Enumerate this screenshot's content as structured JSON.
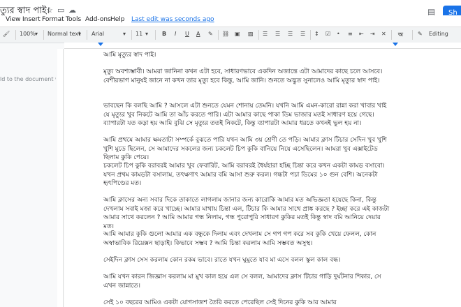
{
  "title": "ত্যুর স্বাদ পাই।",
  "menu": {
    "items": [
      "View",
      "Insert",
      "Format",
      "Tools",
      "Add-ons",
      "Help"
    ],
    "last_edit": "Last edit was seconds ago"
  },
  "share": {
    "label": "Sh"
  },
  "toolbar": {
    "zoom": "100%",
    "style": "Normal text",
    "font": "Arial",
    "size": "11",
    "mode": "Editing"
  },
  "outline_hint": "ld to the document will",
  "document": {
    "paragraphs": [
      "আমি মৃত্যুর স্বাদ পাই।",
      "মৃত্যু অবশ্যম্ভাবী। আমরা জানিনা কখন এটা হবে, সাধারণভাবে একদিন অজান্তে এটা আমাদের কাছে চলে আসবে। বেশীরভাগ মানুষই জানে না কখন তার মৃত্যু হবে কিন্তু, আমি জানি। শুনতে অদ্ভুত সুনালেও আমি মৃত্যুর স্বাদ পাই।",
      "ভাবছেন কি বলছি আমি ? আসলে এটা শুনতে যেমন শোনায় তেমনি। যখনি আমি এমন-কারো রান্না করা খাবার খাই যে মৃত্যুর খুব নিকটে আমি তা আঁচ করতে পারি। এটা আমার কাছে পাকা ডিম ভাজার মতই সাধারণ হয়ে গেছে। ব্যাপারটা যত কড়া হয় আমি বুঝি সে মৃত্যুর ততই নিকটে, কিন্তু ব্যাপারটা আমার ধরতে কখনই ভুল হয় না।",
      "আমি প্রথমে আমার ক্ষমতাটা সম্পর্কে বুঝতে পারি যখন আমি ৩য় শ্রেণী তে পড়ি। আমার ক্লাস টিচার সেদিন খুব খুশি খুশি মুডে ছিলেন, সে আমাদের সকলের জন্য চকলেট চিপ কুকি বানিয়ে নিয়ে এসেছিলেন। আমরা খুব এক্সাইটেড ছিলাম কুকি পেয়ে।",
      "চকলেট চিপ কুকি বরাবরই আমার খুব ফেবারিট, আমি বরাবরই ধৈর্যহারা হচ্ছি চিন্তা করে কখন একটা কামড় বসাবো। যখন প্রথম কামড়টা বসালাম, তৎক্ষণাৎ আমার বমি আসা শুরু করল। গন্ধটা পচা ডিমের ১০ গুন বেশি। অনেকটা হৃৎপিণ্ডের মত।",
      "আমি ক্লাসের অন্য সবার দিকে তাকাতে লাগলাম জানার জন্য কারোকি আমার মত অভিজ্ঞতা হয়েছে কিনা, কিন্তু দেখলাম সবাই মজা করে খাচ্ছে। আমার মাথায় চিন্তা এল, টিচার কি আমার সাথে প্রাঙ্ক করছে ? ইচ্ছা করে এই কাজটা আমার সাথে করলেন ? আমি আমার গন্ধ নিলাম, গন্ধ পুরোপুরি সাধারণ কুকির মতই কিন্তু স্বাদ বমি আনিয়ে দেয়ার মত।",
      "আমি আমার কুকি গুলো আমার এক বন্ধুকে দিলাম এবং দেখলাম সে গপ গপ করে সব কুকি খেয়ে ফেলল, কোন অস্বাভাবিক রিয়েক্সন ছাড়াই। কিভাবে সম্ভব ? আমি চিন্তা করলাম আমি সম্ভবত অসুস্থ।",
      "সেইদিন ক্লাস সেস করলাম কোন রকম ভাবে। রাতে যখন ঘুমুতে যাব মা এসে বলল স্কুল কাল বন্ধ।",
      "আমি যখন কারন জিজ্ঞাস করলাম মা মুখ কাল হয়ে এল সে বলল, আমাদের ক্লাস টিচার গাড়ি দুর্ঘটনার শিকার, সে এখন জান্নাতে।",
      "সেই ১০ বছরের আমিও একটা যোগসাজশ তৈরি করতে পেরেছিল সেই দিনের কুকি আর আমার"
    ],
    "paragraph_tops": [
      3,
      27,
      76,
      125,
      162,
      211,
      260,
      297,
      321,
      358
    ]
  }
}
